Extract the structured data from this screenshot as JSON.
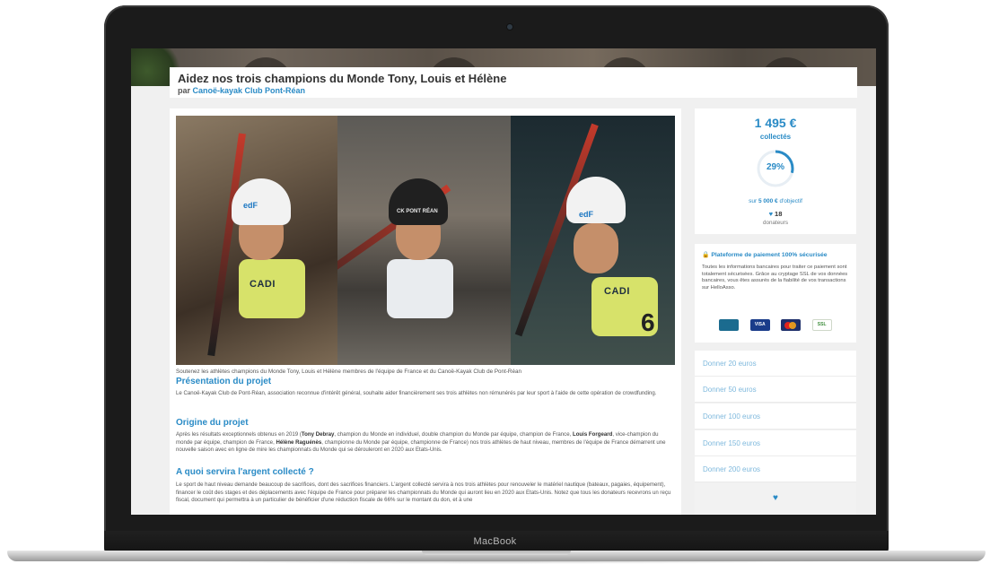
{
  "device": {
    "brand": "MacBook"
  },
  "page": {
    "title": "Aidez nos trois champions du Monde Tony, Louis et Hélène",
    "by_prefix": "par",
    "organization": "Canoë-kayak Club Pont-Réan"
  },
  "photos": {
    "helmet_logo_1": "edF",
    "helmet_logo_2": "CK PONT RÉAN",
    "helmet_logo_3": "edF",
    "bib_1": "CADI",
    "bib_3": "CADI",
    "bib_number_3": "6"
  },
  "content": {
    "caption": "Soutenez les athlètes champions du Monde Tony, Louis et Hélène membres de l'équipe de France et du Canoë-Kayak Club de Pont-Réan",
    "sections": [
      {
        "heading": "Présentation du projet",
        "text": "Le Canoë-Kayak Club de Pont-Réan, association reconnue d'intérêt général, souhaite aider financièrement ses trois athlètes non rémunérés par leur sport à l'aide de cette opération de crowdfunding."
      },
      {
        "heading": "Origine du projet",
        "text_parts": [
          "Après les résultats exceptionnels obtenus en 2019 (",
          "Tony Debray",
          ", champion du Monde en individuel, double champion du Monde par équipe, champion de France, ",
          "Louis Forgeard",
          ", vice-champion du monde par équipe, champion de France, ",
          "Hélène Raguénès",
          ", championne du Monde par équipe, championne de France) nos trois athlètes de haut niveau, membres de l'équipe de France démarrent une nouvelle saison avec en ligne de mire les championnats du Monde qui se dérouleront en 2020 aux Etats-Unis."
        ]
      },
      {
        "heading": "A quoi servira l'argent collecté ?",
        "text": "Le sport de haut niveau demande beaucoup de sacrifices, dont des sacrifices financiers. L'argent collecté servira à nos trois athlètes pour renouveler le matériel nautique (bateaux, pagaies, équipement), financer le coût des stages et des déplacements avec l'équipe de France pour préparer les championnats du Monde qui auront lieu en 2020 aux Etats-Unis. Notez que tous les donateurs recevrons un reçu fiscal, document qui permettra à un particulier de bénéficier d'une réduction fiscale de 66% sur le montant du don, et à une"
      }
    ]
  },
  "funding": {
    "amount": "1 495 €",
    "collected_label": "collectés",
    "percent_label": "29%",
    "percent_value": 0.29,
    "goal_prefix": "sur",
    "goal_amount": "5 000 €",
    "goal_suffix": "d'objectif",
    "donor_count": "18",
    "donor_label": "donateurs"
  },
  "security": {
    "title": "Plateforme de paiement 100% sécurisée",
    "text": "Toutes les informations bancaires pour traiter ce paiement sont totalement sécurisées. Grâce au cryptage SSL de vos données bancaires, vous êtes assurés de la fiabilité de vos transactions sur HelloAsso.",
    "card_visa": "VISA",
    "card_ssl": "SSL"
  },
  "donate_options": [
    "Donner 20 euros",
    "Donner 50 euros",
    "Donner 100 euros",
    "Donner 150 euros",
    "Donner 200 euros"
  ],
  "colors": {
    "accent": "#2a8bc6",
    "link_light": "#7fb9dd",
    "text": "#555555"
  },
  "icons": {
    "lock": "lock-icon",
    "heart": "heart-icon"
  }
}
